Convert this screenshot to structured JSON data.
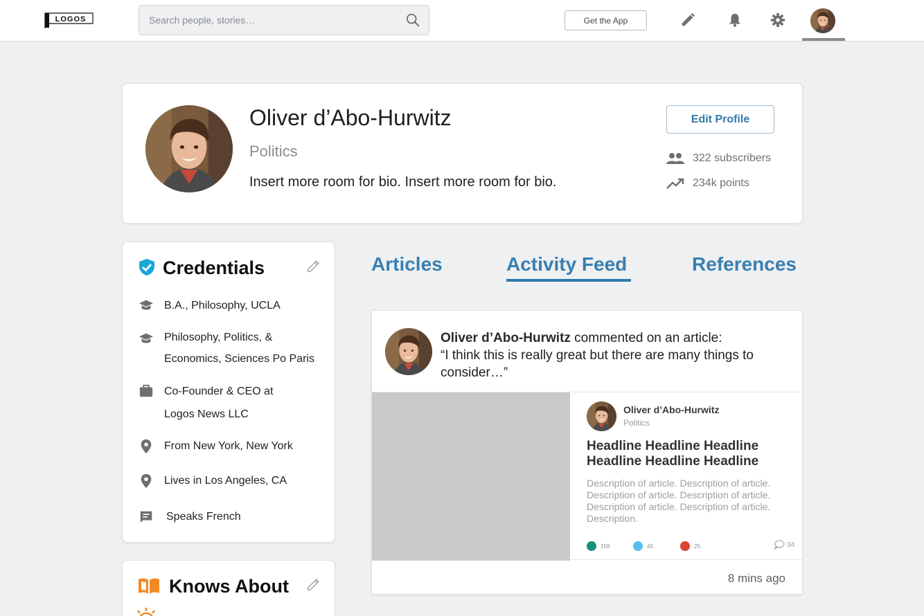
{
  "header": {
    "logo_text": "LOGOS",
    "search": {
      "placeholder": "Search people, stories…",
      "value": ""
    },
    "get_app_label": "Get the App",
    "icons": [
      "pencil-icon",
      "bell-icon",
      "gear-icon",
      "user-avatar"
    ]
  },
  "profile": {
    "name": "Oliver d’Abo-Hurwitz",
    "topic": "Politics",
    "bio": "Insert more room for bio. Insert more room for bio.",
    "edit_label": "Edit Profile",
    "subscribers": "322 subscribers",
    "points": "234k points"
  },
  "credentials": {
    "title": "Credentials",
    "items": [
      {
        "icon": "graduation-cap-icon",
        "text": "B.A., Philosophy, UCLA"
      },
      {
        "icon": "graduation-cap-icon",
        "line1": "Philosophy, Politics, &",
        "line2": "Economics, Sciences Po Paris"
      },
      {
        "icon": "briefcase-icon",
        "line1": "Co-Founder & CEO at",
        "line2": "Logos News LLC"
      },
      {
        "icon": "location-pin-icon",
        "text": "From New York, New York"
      },
      {
        "icon": "location-pin-icon",
        "text": "Lives in Los Angeles, CA"
      },
      {
        "icon": "speech-bubble-icon",
        "text": "Speaks French"
      }
    ]
  },
  "knows_about": {
    "title": "Knows About"
  },
  "tabs": [
    {
      "label": "Articles",
      "active": false
    },
    {
      "label": "Activity Feed",
      "active": true
    },
    {
      "label": "References",
      "active": false
    }
  ],
  "activity": {
    "actor": "Oliver d’Abo-Hurwitz",
    "action": " commented on an article:",
    "quote": "“I think this is really great but there are many things to consider…”",
    "article": {
      "author": "Oliver d’Abo-Hurwitz",
      "topic": "Politics",
      "headline": "Headline Headline Headline Headline Headline Headline",
      "description": "Description of article. Description of article. Description of article. Description of article. Description of article. Description of article. Description.",
      "reactions": [
        {
          "color": "#16907f",
          "count": "159"
        },
        {
          "color": "#55c0ee",
          "count": "40"
        },
        {
          "color": "#d94436",
          "count": "25"
        }
      ],
      "comments": "34"
    },
    "time": "8 mins ago"
  },
  "colors": {
    "accent": "#2e7aac",
    "credential_badge": "#1aa6d9",
    "knows_about_accent": "#f08a26",
    "page_background": "#eef0f2"
  }
}
